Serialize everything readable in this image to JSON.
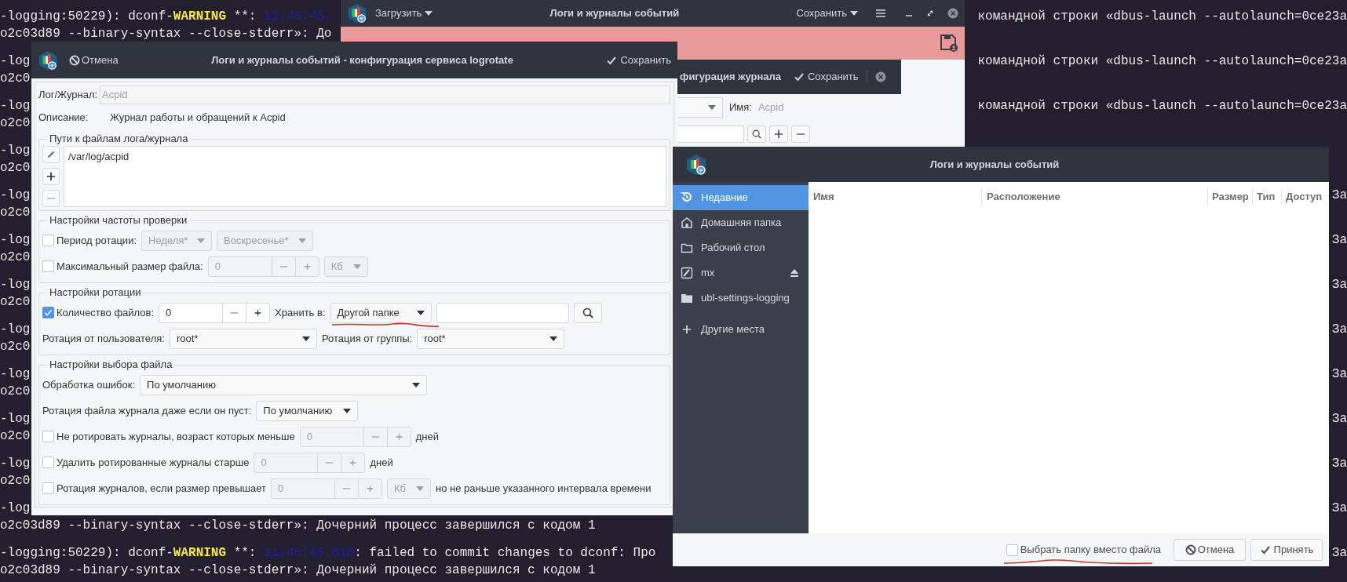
{
  "terminal": {
    "rows": [
      {
        "lines": [
          {
            "left": [
              {
                "kind": "text",
                "text": "-logging:50229): dconf-"
              },
              {
                "kind": "warning",
                "text": "WARNING"
              },
              {
                "kind": "text",
                "text": " **: "
              },
              {
                "kind": "time",
                "text": "11:46:46."
              }
            ],
            "right": "командной строки «dbus-launch --autolaunch=0ce23a"
          },
          {
            "left": [
              {
                "kind": "text",
                "text": "o2c03d89 --binary-syntax --close-stderr»: До"
              }
            ]
          }
        ]
      },
      {
        "lines": [
          {
            "left": [
              {
                "kind": "text",
                "text": "-log"
              }
            ],
            "right": "командной строки «dbus-launch --autolaunch=0ce23a"
          },
          {
            "left": [
              {
                "kind": "text",
                "text": "o2c0"
              }
            ]
          }
        ]
      },
      {
        "lines": [
          {
            "left": [
              {
                "kind": "text",
                "text": "-log"
              }
            ],
            "right": "командной строки «dbus-launch --autolaunch=0ce23a"
          },
          {
            "left": [
              {
                "kind": "text",
                "text": "o2c0"
              }
            ]
          }
        ]
      },
      {
        "lines": [
          {
            "left": [
              {
                "kind": "text",
                "text": "-log"
              }
            ]
          },
          {
            "left": [
              {
                "kind": "text",
                "text": "o2c0"
              }
            ]
          }
        ]
      },
      {
        "lines": [
          {
            "left": [
              {
                "kind": "text",
                "text": "-log"
              }
            ],
            "right": "За"
          },
          {
            "left": [
              {
                "kind": "text",
                "text": "o2c0"
              }
            ]
          }
        ]
      },
      {
        "lines": [
          {
            "left": [
              {
                "kind": "text",
                "text": "-log"
              }
            ],
            "right": "За"
          },
          {
            "left": [
              {
                "kind": "text",
                "text": "o2c0"
              }
            ]
          }
        ]
      },
      {
        "lines": [
          {
            "left": [
              {
                "kind": "text",
                "text": "-log"
              }
            ],
            "right": "За"
          },
          {
            "left": [
              {
                "kind": "text",
                "text": "o2c0"
              }
            ]
          }
        ]
      },
      {
        "lines": [
          {
            "left": [
              {
                "kind": "text",
                "text": "-log"
              }
            ],
            "right": "За"
          },
          {
            "left": [
              {
                "kind": "text",
                "text": "o2c0"
              }
            ]
          }
        ]
      },
      {
        "lines": [
          {
            "left": [
              {
                "kind": "text",
                "text": "-log"
              }
            ],
            "right": "За"
          },
          {
            "left": [
              {
                "kind": "text",
                "text": "o2c0"
              }
            ]
          }
        ]
      },
      {
        "lines": [
          {
            "left": [
              {
                "kind": "text",
                "text": "-log"
              }
            ],
            "right": "За"
          },
          {
            "left": [
              {
                "kind": "text",
                "text": "o2c0"
              }
            ]
          }
        ]
      },
      {
        "lines": [
          {
            "left": [
              {
                "kind": "text",
                "text": "-log"
              }
            ],
            "right": "За"
          },
          {
            "left": [
              {
                "kind": "text",
                "text": "o2c0"
              }
            ]
          }
        ]
      },
      {
        "lines": [
          {
            "left": [
              {
                "kind": "text",
                "text": "-log"
              }
            ],
            "right": "За"
          },
          {
            "left": [
              {
                "kind": "text",
                "text": "o2c03d89 --binary-syntax --close-stderr»: Дочерний процесс завершился с кодом 1"
              }
            ]
          }
        ]
      },
      {
        "lines": [
          {
            "left": [
              {
                "kind": "text",
                "text": "-logging:50229): dconf-"
              },
              {
                "kind": "warning",
                "text": "WARNING"
              },
              {
                "kind": "text",
                "text": " **: "
              },
              {
                "kind": "time",
                "text": "11:46:46.818"
              },
              {
                "kind": "text",
                "text": ": failed to commit changes to dconf: Про"
              }
            ],
            "right": "За"
          },
          {
            "left": [
              {
                "kind": "text",
                "text": "o2c03d89 --binary-syntax --close-stderr»: Дочерний процесс завершился с кодом 1"
              }
            ]
          }
        ]
      }
    ]
  },
  "main_window": {
    "title": "Логи и журналы событий",
    "load_menu": "Загрузить",
    "save_menu": "Сохранить"
  },
  "journal_window": {
    "title": "фигурация журнала",
    "save_button": "Сохранить",
    "name_label": "Имя:",
    "name_value": "Acpid"
  },
  "logrotate_window": {
    "title": "Логи и журналы событий - конфигурация сервиса logrotate",
    "cancel_button": "Отмена",
    "save_button": "Сохранить",
    "log_label": "Лог/Журнал:",
    "log_value": "Acpid",
    "description_label": "Описание:",
    "description": "Журнал работы и обращений к Acpid",
    "paths": {
      "legend": "Пути к файлам лога/журнала",
      "items": [
        "/var/log/acpid"
      ]
    },
    "sections": [
      {
        "legend": "Настройки частоты проверки",
        "rows": [
          {
            "controls": [
              {
                "kind": "checkbox",
                "label": "Период ротации:",
                "checked": false
              },
              {
                "kind": "dropdown",
                "value": "Неделя*",
                "disabled": true
              },
              {
                "kind": "dropdown",
                "value": "Воскресенье*",
                "disabled": true
              }
            ]
          },
          {
            "controls": [
              {
                "kind": "checkbox",
                "label": "Максимальный размер файла:",
                "checked": false
              },
              {
                "kind": "spinner",
                "value": "0",
                "disabled": true
              },
              {
                "kind": "dropdown",
                "value": "Кб",
                "disabled": true
              }
            ]
          }
        ]
      },
      {
        "legend": "Настройки ротации",
        "rows": [
          {
            "controls": [
              {
                "kind": "checkbox",
                "label": "Количество файлов:",
                "checked": true
              },
              {
                "kind": "spinner",
                "value": "0",
                "disabled": false
              },
              {
                "kind": "label",
                "text": "Хранить в:"
              },
              {
                "kind": "dropdown",
                "value": "Другой папке",
                "disabled": false,
                "annotated": true
              },
              {
                "kind": "text_field"
              },
              {
                "kind": "search_button"
              }
            ]
          },
          {
            "controls": [
              {
                "kind": "label",
                "text": "Ротация от пользователя:"
              },
              {
                "kind": "dropdown",
                "value": "root*",
                "disabled": false
              },
              {
                "kind": "label",
                "text": "Ротация от группы:"
              },
              {
                "kind": "dropdown",
                "value": "root*",
                "disabled": false
              }
            ]
          }
        ]
      },
      {
        "legend": "Настройки выбора файла",
        "rows": [
          {
            "controls": [
              {
                "kind": "label",
                "text": "Обработка ошибок:"
              },
              {
                "kind": "dropdown",
                "value": "По умолчанию",
                "disabled": false
              }
            ]
          },
          {
            "controls": [
              {
                "kind": "label",
                "text": "Ротация файла журнала даже если он пуст:"
              },
              {
                "kind": "dropdown",
                "value": "По умолчанию",
                "disabled": false
              }
            ]
          },
          {
            "controls": [
              {
                "kind": "checkbox",
                "label": "Не ротировать журналы, возраст которых меньше",
                "checked": false
              },
              {
                "kind": "spinner",
                "value": "0",
                "disabled": true
              },
              {
                "kind": "label",
                "text": "дней"
              }
            ]
          },
          {
            "controls": [
              {
                "kind": "checkbox",
                "label": "Удалить ротированные журналы старше",
                "checked": false
              },
              {
                "kind": "spinner",
                "value": "0",
                "disabled": true
              },
              {
                "kind": "label",
                "text": "дней"
              }
            ]
          },
          {
            "controls": [
              {
                "kind": "checkbox",
                "label": "Ротация журналов, если размер превышает",
                "checked": false
              },
              {
                "kind": "spinner",
                "value": "0",
                "disabled": true
              },
              {
                "kind": "dropdown",
                "value": "Кб",
                "disabled": true
              },
              {
                "kind": "label",
                "text": "но не раньше указанного интервала времени"
              }
            ]
          }
        ]
      }
    ]
  },
  "file_chooser": {
    "title": "Логи и журналы событий",
    "places": [
      {
        "kind": "recent",
        "label": "Недавние",
        "selected": true,
        "ejectable": false
      },
      {
        "kind": "home",
        "label": "Домашняя папка",
        "selected": false,
        "ejectable": false
      },
      {
        "kind": "folder",
        "label": "Рабочий стол",
        "selected": false,
        "ejectable": false
      },
      {
        "kind": "drive",
        "label": "mx",
        "selected": false,
        "ejectable": true
      },
      {
        "kind": "folder_filled",
        "label": "ubl-settings-logging",
        "selected": false,
        "ejectable": false
      }
    ],
    "other_places": "Другие места",
    "columns": [
      "Имя",
      "Расположение",
      "Размер",
      "Тип",
      "Доступ"
    ],
    "folder_toggle": {
      "label": "Выбрать папку вместо файла",
      "checked": false,
      "annotated": true
    },
    "cancel_button": "Отмена",
    "accept_button": "Принять"
  }
}
